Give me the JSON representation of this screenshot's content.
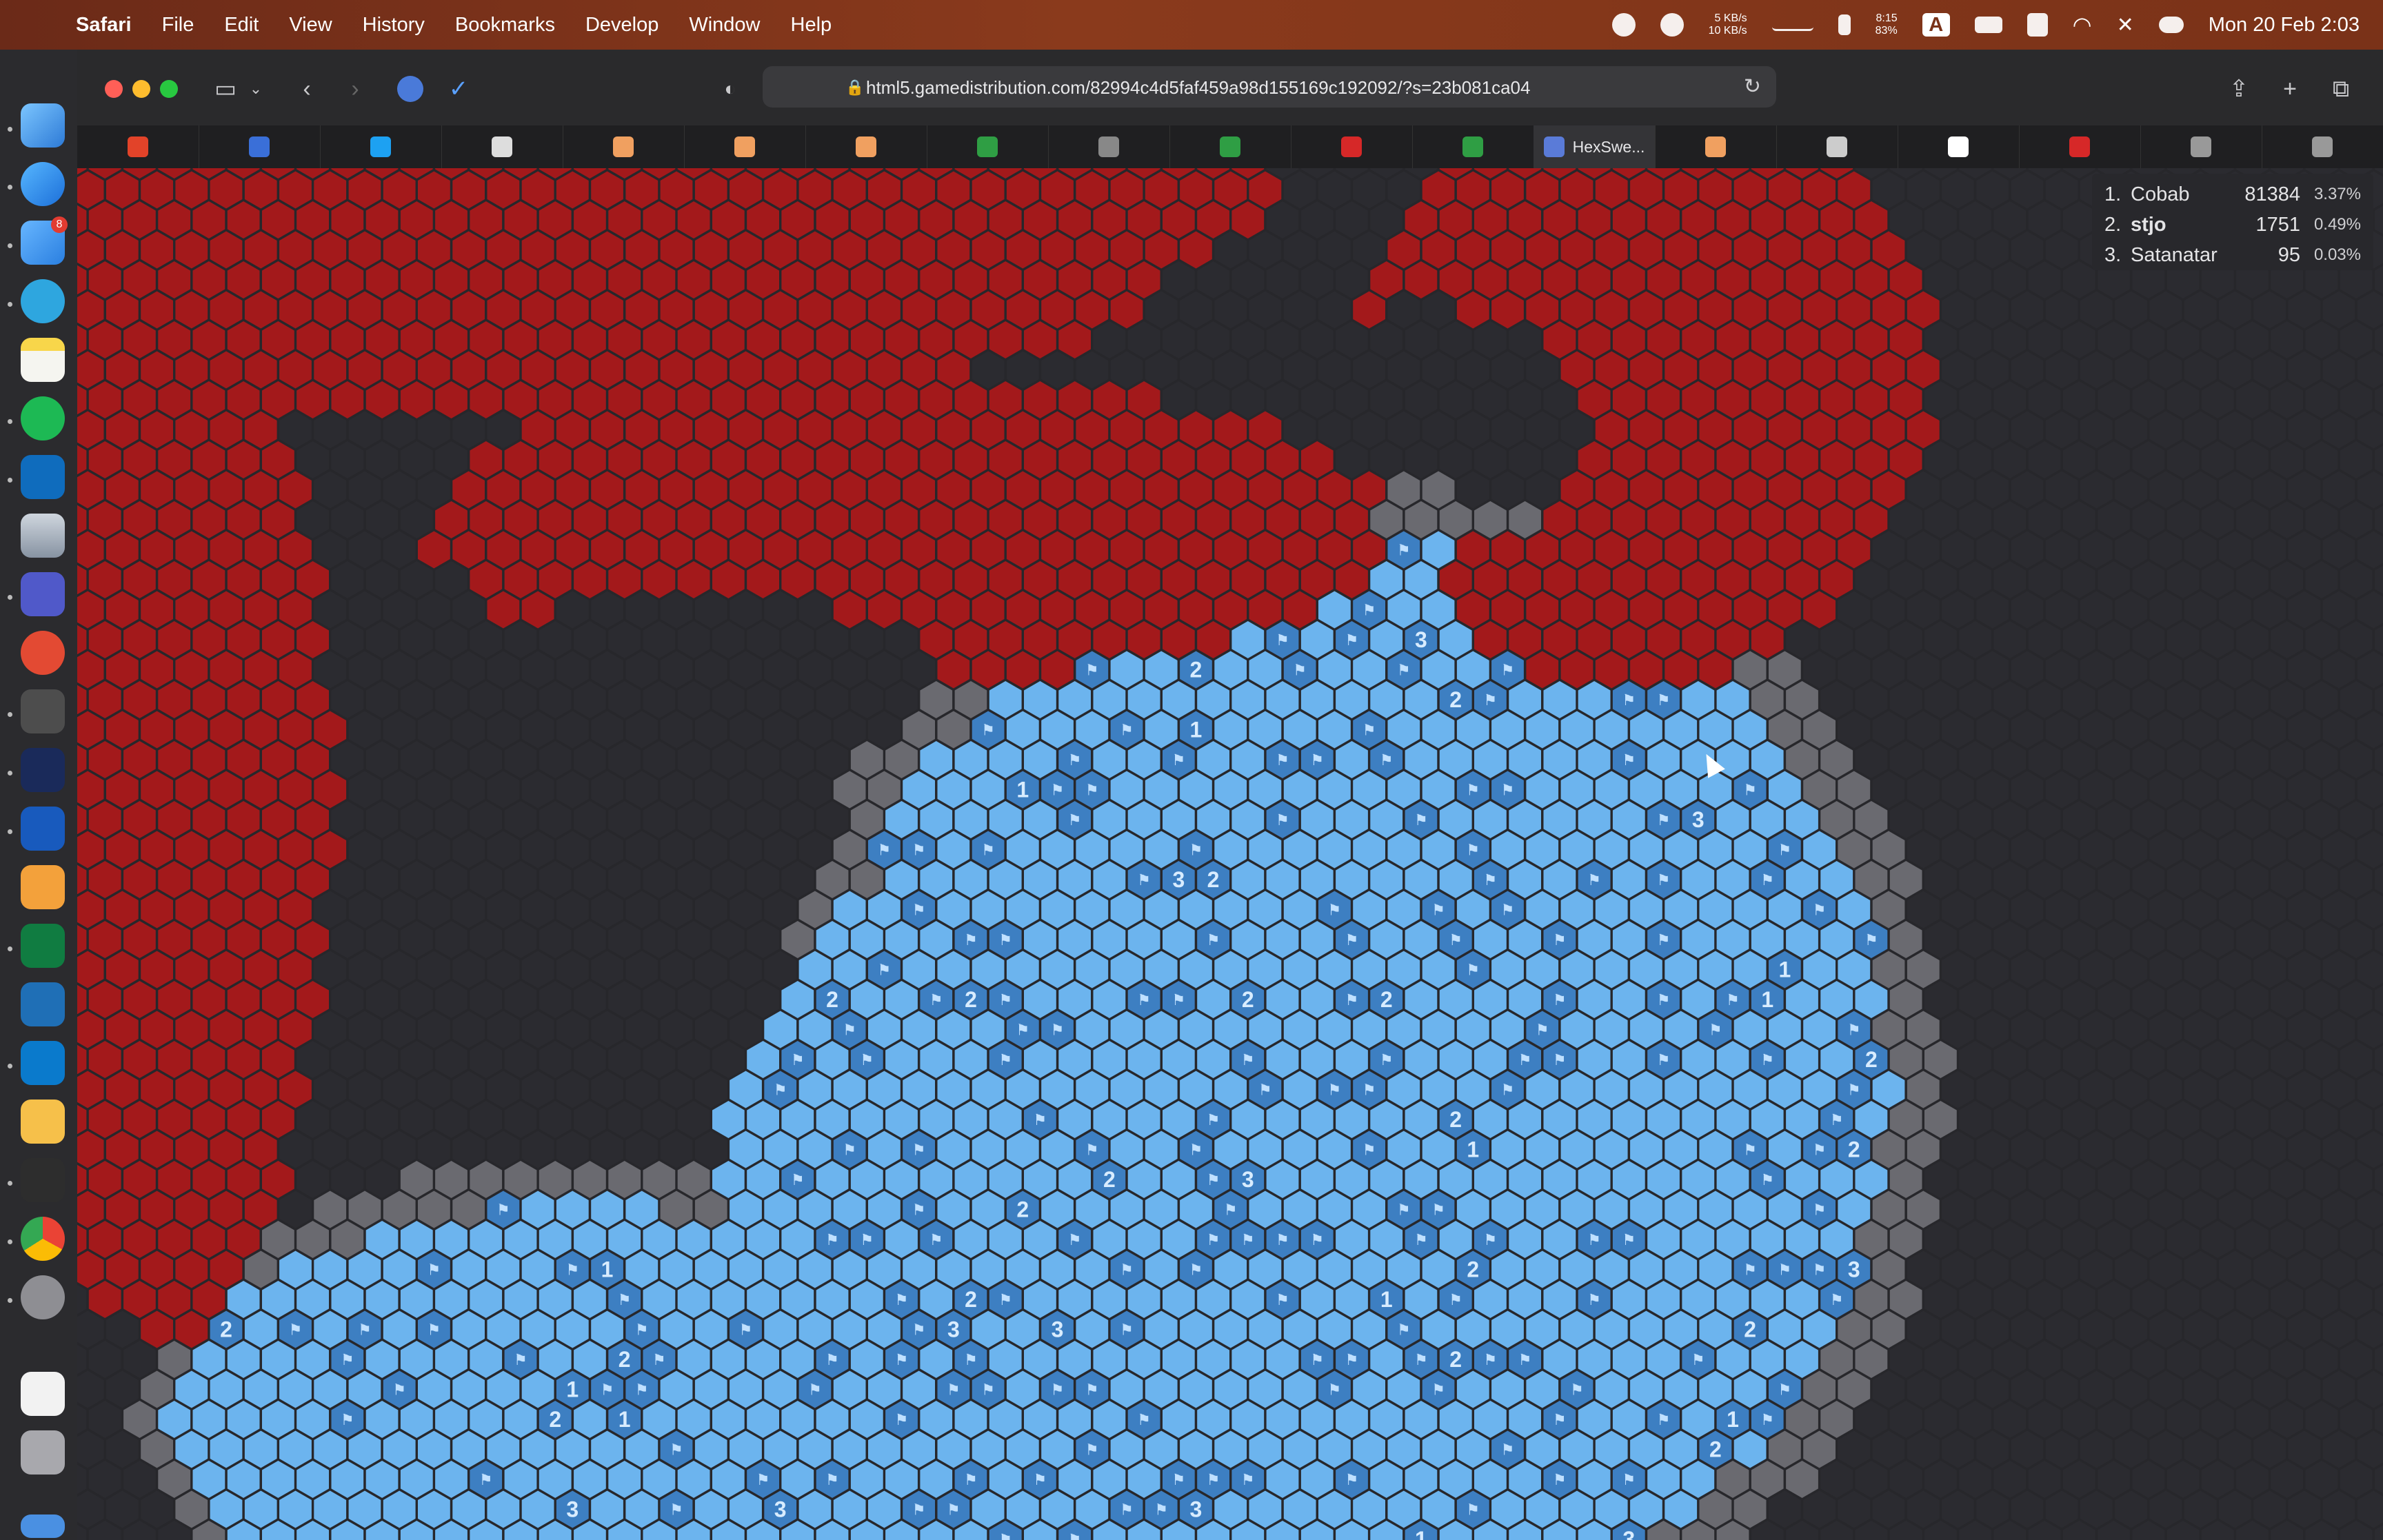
{
  "menubar": {
    "app_name": "Safari",
    "items": [
      "File",
      "Edit",
      "View",
      "History",
      "Bookmarks",
      "Develop",
      "Window",
      "Help"
    ],
    "network_up": "5 KB/s",
    "network_down": "10 KB/s",
    "battery_time": "8:15",
    "battery_pct": "83%",
    "input_source": "A",
    "datetime": "Mon 20 Feb 2:03"
  },
  "browser": {
    "url": "html5.gamedistribution.com/82994c4d5faf459a98d155169c192092/?s=23b081ca04",
    "active_tab_title": "HexSwe...",
    "tabs": [
      "gitlab",
      "extension",
      "twitter",
      "github",
      "page",
      "page",
      "page",
      "hex",
      "M",
      "hex",
      "red",
      "hex",
      "HexSwe...",
      "page",
      "reader",
      "dg",
      "app",
      "O",
      "O"
    ]
  },
  "leaderboard": [
    {
      "rank": "1.",
      "name": "Cobab",
      "score": "81384",
      "pct": "3.37%"
    },
    {
      "rank": "2.",
      "name": "stjo",
      "score": "1751",
      "pct": "0.49%"
    },
    {
      "rank": "3.",
      "name": "Satanatar",
      "score": "95",
      "pct": "0.03%"
    }
  ],
  "colors": {
    "opponent": "#a3191b",
    "revealed": "#6cb4ee",
    "flag": "#3d7fc2",
    "border_gray": "#6a6a70",
    "unrevealed": "#2b2b30"
  }
}
